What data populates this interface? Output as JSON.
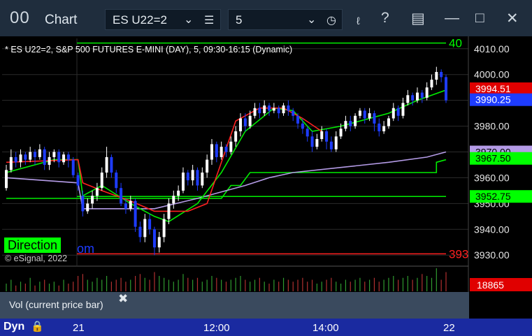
{
  "toolbar": {
    "logo": "00",
    "title": "Chart",
    "symbol_value": "ES U22=2",
    "interval_value": "5"
  },
  "chart_title": "* ES U22=2, S&P 500 FUTURES E-MINI (DAY), 5, 09:30-16:15 (Dynamic)",
  "watermark": "© eSignal, 2022",
  "direction": {
    "label": "Direction",
    "tail": "om"
  },
  "volume_panel": {
    "label": "Vol (current price bar)",
    "close": "✖"
  },
  "bottom": {
    "mode": "Dyn",
    "time_ticks": [
      "21",
      "12:00",
      "14:00",
      "22"
    ]
  },
  "colors": {
    "up": "#ffffff",
    "down": "#1e3cff",
    "red_ma": "#ff2020",
    "green_ma": "#00ee00",
    "purple_ma": "#b49be6",
    "axis_bg": "#000000"
  },
  "chart_data": {
    "type": "candlestick",
    "ylim": [
      3926,
      4014
    ],
    "y_ticks": [
      4010,
      4000,
      3990,
      3980,
      3970,
      3960,
      3950,
      3940,
      3930
    ],
    "y_tick_labels": [
      "4010.00",
      "4000.00",
      "3990.00",
      "3980.00",
      "3970.00",
      "3960.00",
      "3950.00",
      "3940.00",
      "3930.00"
    ],
    "price_badges": [
      {
        "text": "3994.51",
        "value": 3994.5,
        "color": "#e00000"
      },
      {
        "text": "3990.25",
        "value": 3990.25,
        "color": "#1e3cff"
      },
      {
        "text": "3970.00",
        "value": 3970.0,
        "color": "#b49be6"
      },
      {
        "text": "3967.50",
        "value": 3967.5,
        "color": "#00ff00"
      },
      {
        "text": "3952.75",
        "value": 3952.75,
        "color": "#00ff00"
      }
    ],
    "edge_labels": [
      {
        "text": "40",
        "value": 4012.2,
        "color": "#00ff00"
      },
      {
        "text": "393",
        "value": 3930.5,
        "color": "#ff2020"
      }
    ],
    "hlines": [
      {
        "value": 4012.2,
        "color": "#00ee00"
      },
      {
        "value": 3952.75,
        "color": "#00ee00"
      },
      {
        "value": 3930.5,
        "color": "#ff2020"
      }
    ],
    "candles": [
      [
        3956,
        3963,
        3955,
        3965
      ],
      [
        3963,
        3968,
        3962,
        3971
      ],
      [
        3968,
        3966,
        3964,
        3970
      ],
      [
        3966,
        3969,
        3964,
        3971
      ],
      [
        3969,
        3967,
        3965,
        3970
      ],
      [
        3967,
        3970,
        3966,
        3972
      ],
      [
        3970,
        3968,
        3965,
        3971
      ],
      [
        3968,
        3971,
        3967,
        3973
      ],
      [
        3971,
        3965,
        3963,
        3972
      ],
      [
        3965,
        3968,
        3963,
        3970
      ],
      [
        3968,
        3970,
        3966,
        3971
      ],
      [
        3970,
        3966,
        3964,
        3971
      ],
      [
        3966,
        3969,
        3965,
        3970
      ],
      [
        3969,
        3967,
        3964,
        3970
      ],
      [
        3967,
        3961,
        3960,
        3968
      ],
      [
        3961,
        3957,
        3955,
        3962
      ],
      [
        3953,
        3947,
        3945,
        3955
      ],
      [
        3947,
        3950,
        3946,
        3952
      ],
      [
        3950,
        3953,
        3948,
        3955
      ],
      [
        3953,
        3956,
        3951,
        3958
      ],
      [
        3956,
        3962,
        3955,
        3964
      ],
      [
        3962,
        3968,
        3960,
        3972
      ],
      [
        3968,
        3962,
        3960,
        3969
      ],
      [
        3962,
        3956,
        3954,
        3963
      ],
      [
        3956,
        3950,
        3949,
        3958
      ],
      [
        3950,
        3948,
        3946,
        3952
      ],
      [
        3948,
        3951,
        3947,
        3953
      ],
      [
        3951,
        3941,
        3939,
        3952
      ],
      [
        3941,
        3937,
        3935,
        3943
      ],
      [
        3937,
        3944,
        3935,
        3946
      ],
      [
        3944,
        3940,
        3938,
        3946
      ],
      [
        3940,
        3933,
        3930,
        3941
      ],
      [
        3933,
        3937,
        3931,
        3939
      ],
      [
        3937,
        3944,
        3935,
        3946
      ],
      [
        3944,
        3950,
        3942,
        3952
      ],
      [
        3950,
        3953,
        3948,
        3955
      ],
      [
        3953,
        3955,
        3951,
        3957
      ],
      [
        3955,
        3962,
        3954,
        3964
      ],
      [
        3962,
        3959,
        3957,
        3963
      ],
      [
        3959,
        3963,
        3957,
        3965
      ],
      [
        3963,
        3957,
        3955,
        3964
      ],
      [
        3957,
        3962,
        3956,
        3964
      ],
      [
        3962,
        3967,
        3960,
        3969
      ],
      [
        3967,
        3973,
        3965,
        3975
      ],
      [
        3973,
        3968,
        3966,
        3974
      ],
      [
        3968,
        3972,
        3967,
        3974
      ],
      [
        3972,
        3970,
        3968,
        3973
      ],
      [
        3970,
        3974,
        3969,
        3976
      ],
      [
        3974,
        3978,
        3972,
        3980
      ],
      [
        3978,
        3983,
        3976,
        3985
      ],
      [
        3983,
        3980,
        3978,
        3985
      ],
      [
        3980,
        3984,
        3979,
        3986
      ],
      [
        3984,
        3987,
        3983,
        3989
      ],
      [
        3987,
        3985,
        3983,
        3989
      ],
      [
        3985,
        3988,
        3984,
        3990
      ],
      [
        3988,
        3986,
        3984,
        3989
      ],
      [
        3986,
        3987,
        3985,
        3989
      ],
      [
        3987,
        3985,
        3983,
        3988
      ],
      [
        3985,
        3988,
        3984,
        3989
      ],
      [
        3988,
        3986,
        3984,
        3990
      ],
      [
        3986,
        3984,
        3982,
        3987
      ],
      [
        3984,
        3981,
        3979,
        3985
      ],
      [
        3981,
        3979,
        3977,
        3983
      ],
      [
        3979,
        3976,
        3974,
        3980
      ],
      [
        3976,
        3972,
        3970,
        3978
      ],
      [
        3972,
        3975,
        3971,
        3977
      ],
      [
        3975,
        3978,
        3974,
        3980
      ],
      [
        3978,
        3974,
        3971,
        3979
      ],
      [
        3974,
        3971,
        3970,
        3976
      ],
      [
        3971,
        3976,
        3970,
        3978
      ],
      [
        3976,
        3979,
        3975,
        3981
      ],
      [
        3979,
        3982,
        3978,
        3984
      ],
      [
        3982,
        3980,
        3978,
        3984
      ],
      [
        3980,
        3984,
        3979,
        3985
      ],
      [
        3984,
        3986,
        3983,
        3987
      ],
      [
        3986,
        3983,
        3981,
        3987
      ],
      [
        3983,
        3985,
        3982,
        3987
      ],
      [
        3985,
        3981,
        3978,
        3986
      ],
      [
        3981,
        3978,
        3976,
        3983
      ],
      [
        3978,
        3980,
        3977,
        3982
      ],
      [
        3980,
        3983,
        3979,
        3984
      ],
      [
        3983,
        3987,
        3982,
        3989
      ],
      [
        3987,
        3984,
        3982,
        3988
      ],
      [
        3984,
        3989,
        3983,
        3991
      ],
      [
        3989,
        3992,
        3988,
        3994
      ],
      [
        3992,
        3990,
        3988,
        3993
      ],
      [
        3990,
        3993,
        3989,
        3995
      ],
      [
        3993,
        3991,
        3989,
        3994
      ],
      [
        3991,
        3995,
        3990,
        3997
      ],
      [
        3995,
        3998,
        3994,
        4000
      ],
      [
        3998,
        4001,
        3996,
        4003
      ],
      [
        4001,
        3999,
        3997,
        4002
      ],
      [
        3999,
        3990,
        3989,
        4000
      ]
    ],
    "red_ma": [
      [
        0,
        3966
      ],
      [
        15,
        3967
      ],
      [
        16,
        3958
      ],
      [
        20,
        3955
      ],
      [
        26,
        3951
      ],
      [
        31,
        3947
      ],
      [
        38,
        3947
      ],
      [
        42,
        3950
      ],
      [
        48,
        3982
      ],
      [
        53,
        3987
      ],
      [
        58,
        3987
      ],
      [
        62,
        3983
      ],
      [
        66,
        3978
      ]
    ],
    "green_ma": [
      [
        0,
        3962
      ],
      [
        10,
        3967
      ],
      [
        15,
        3967
      ],
      [
        16,
        3953
      ],
      [
        20,
        3957
      ],
      [
        26,
        3950
      ],
      [
        31,
        3945
      ],
      [
        34,
        3943
      ],
      [
        40,
        3950
      ],
      [
        45,
        3962
      ],
      [
        50,
        3978
      ],
      [
        56,
        3987
      ],
      [
        60,
        3986
      ],
      [
        64,
        3978
      ],
      [
        70,
        3980
      ],
      [
        80,
        3985
      ],
      [
        86,
        3990
      ],
      [
        92,
        3994
      ]
    ],
    "purple_ma": [
      [
        0,
        3960
      ],
      [
        15,
        3958
      ],
      [
        16,
        3948
      ],
      [
        31,
        3948
      ],
      [
        40,
        3952
      ],
      [
        50,
        3957
      ],
      [
        55,
        3960
      ],
      [
        60,
        3962
      ],
      [
        70,
        3964
      ],
      [
        80,
        3966
      ],
      [
        88,
        3968
      ],
      [
        92,
        3970
      ]
    ],
    "step_ma": [
      [
        0,
        3952
      ],
      [
        45,
        3952
      ],
      [
        47,
        3957
      ],
      [
        49,
        3957
      ],
      [
        51,
        3962
      ],
      [
        68,
        3962
      ],
      [
        90,
        3962
      ],
      [
        90,
        3966
      ],
      [
        92,
        3967
      ]
    ],
    "volumes": [
      4,
      6,
      3,
      5,
      4,
      7,
      3,
      5,
      6,
      4,
      5,
      3,
      6,
      4,
      5,
      8,
      9,
      6,
      5,
      7,
      6,
      8,
      5,
      6,
      7,
      5,
      6,
      8,
      9,
      7,
      6,
      10,
      8,
      7,
      6,
      5,
      6,
      9,
      7,
      6,
      7,
      5,
      6,
      8,
      7,
      6,
      5,
      6,
      7,
      8,
      6,
      5,
      6,
      7,
      5,
      4,
      6,
      5,
      7,
      6,
      5,
      6,
      7,
      5,
      6,
      4,
      5,
      6,
      7,
      5,
      4,
      6,
      5,
      6,
      7,
      5,
      6,
      7,
      5,
      6,
      7,
      8,
      6,
      7,
      8,
      6,
      7,
      9,
      8,
      7,
      12,
      6,
      10
    ],
    "volume_badge": "18865"
  }
}
